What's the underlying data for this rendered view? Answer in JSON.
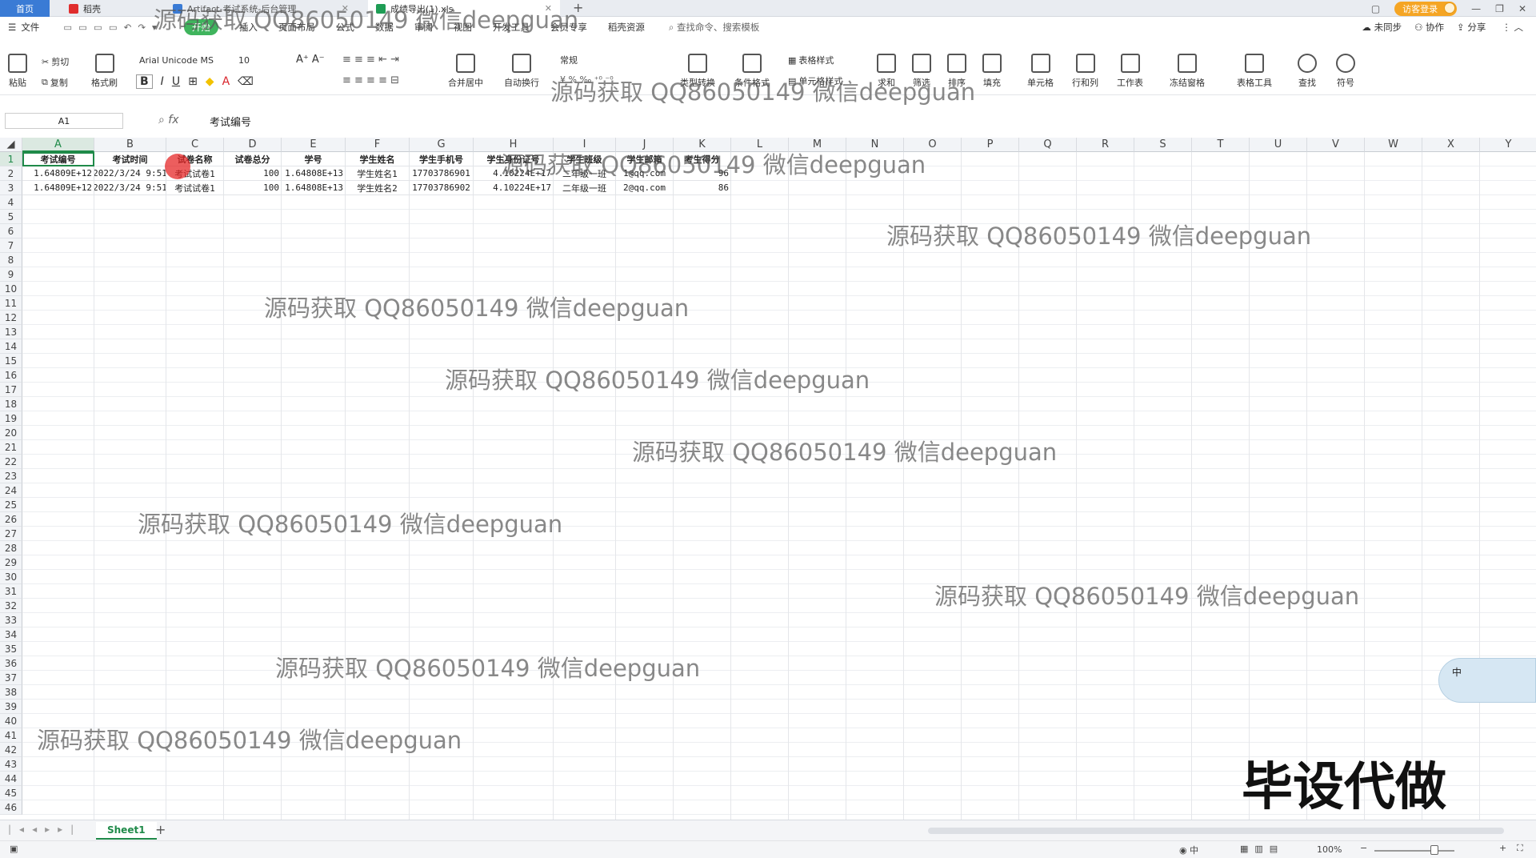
{
  "titlebar": {
    "home": "首页",
    "tab1": "稻壳",
    "tab2": "Artifact-考试系统-后台管理",
    "tab3": "成绩导出(1).xls",
    "new_tab": "+",
    "login": "访客登录"
  },
  "menubar": {
    "file": "文件",
    "items": [
      "开始",
      "插入",
      "页面布局",
      "公式",
      "数据",
      "审阅",
      "视图",
      "开发工具",
      "会员专享",
      "稻壳资源"
    ],
    "search": "查找命令、搜索模板",
    "sync": "未同步",
    "collab": "协作",
    "share": "分享"
  },
  "ribbon": {
    "paste": "粘贴",
    "cut": "剪切",
    "copy": "复制",
    "format_painter": "格式刷",
    "font_name": "Arial Unicode MS",
    "font_size": "10",
    "merge": "合并居中",
    "wrap": "自动换行",
    "number_format": "常规",
    "convert": "类型转换",
    "cond_format": "条件格式",
    "table_style": "表格样式",
    "cell_style": "单元格样式",
    "sum": "求和",
    "filter": "筛选",
    "sort": "排序",
    "fill": "填充",
    "cell": "单元格",
    "rowcol": "行和列",
    "worksheet": "工作表",
    "freeze": "冻结窗格",
    "table_tools": "表格工具",
    "find": "查找",
    "symbol": "符号"
  },
  "formula": {
    "name_box": "A1",
    "fx": "fx",
    "content": "考试编号"
  },
  "columns": [
    "A",
    "B",
    "C",
    "D",
    "E",
    "F",
    "G",
    "H",
    "I",
    "J",
    "K",
    "L",
    "M",
    "N",
    "O",
    "P",
    "Q",
    "R",
    "S",
    "T",
    "U",
    "V",
    "W",
    "X",
    "Y"
  ],
  "rows_count": 46,
  "table": {
    "headers": [
      "考试编号",
      "考试时间",
      "试卷名称",
      "试卷总分",
      "学号",
      "学生姓名",
      "学生手机号",
      "学生身份证号",
      "学生班级",
      "学生邮箱",
      "考生得分"
    ],
    "rows": [
      [
        "1.64809E+12",
        "2022/3/24 9:51",
        "考试试卷1",
        "100",
        "1.64808E+13",
        "学生姓名1",
        "17703786901",
        "4.10224E+17",
        "二年级一班",
        "1@qq.com",
        "96"
      ],
      [
        "1.64809E+12",
        "2022/3/24 9:51",
        "考试试卷1",
        "100",
        "1.64808E+13",
        "学生姓名2",
        "17703786902",
        "4.10224E+17",
        "二年级一班",
        "2@qq.com",
        "86"
      ]
    ]
  },
  "sheet": {
    "name": "Sheet1",
    "add": "+"
  },
  "status": {
    "zoom": "100%"
  },
  "watermark": "源码获取 QQ86050149 微信deepguan",
  "brand_text": "毕设代做"
}
